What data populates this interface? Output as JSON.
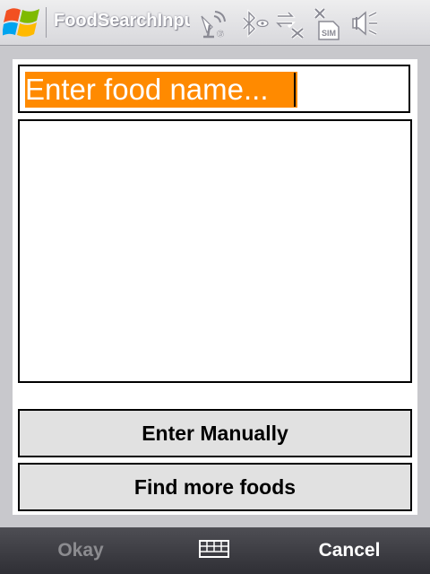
{
  "title_bar": {
    "app_title": "FoodSearchInput",
    "icons": [
      "windows-start-icon",
      "gprs-signal-icon",
      "bluetooth-icon",
      "data-connection-off-icon",
      "no-sim-icon",
      "volume-muted-icon"
    ]
  },
  "search": {
    "value": "Enter food name..."
  },
  "buttons": {
    "enter_manually": "Enter Manually",
    "find_more": "Find more foods"
  },
  "softkeys": {
    "left": "Okay",
    "right": "Cancel",
    "center_icon": "keyboard-icon"
  },
  "colors": {
    "highlight": "#ff8a00",
    "button_bg": "#e1e1e1",
    "softkey_bar": "#3a3a40"
  }
}
